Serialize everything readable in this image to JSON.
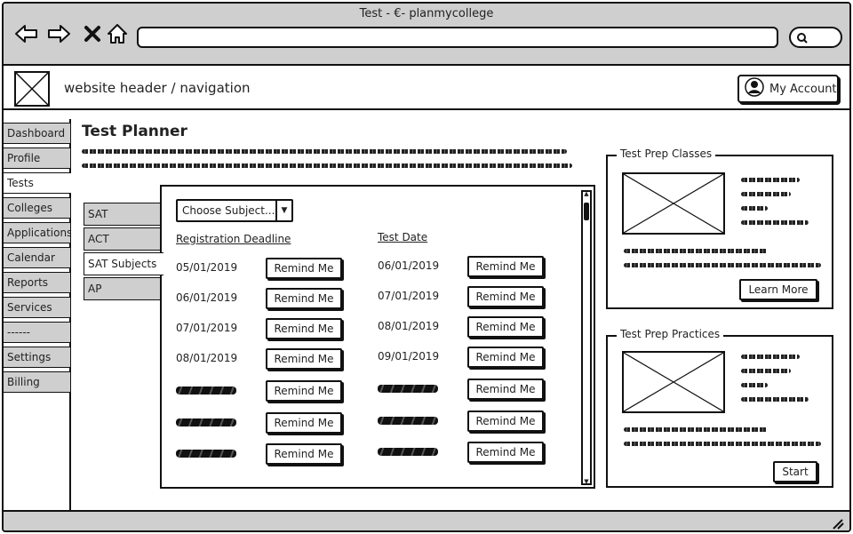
{
  "window": {
    "title": "Test - €- planmycollege"
  },
  "header": {
    "nav_text": "website header / navigation",
    "account_label": "My Account"
  },
  "sidebar": {
    "items": [
      {
        "label": "Dashboard",
        "active": false
      },
      {
        "label": "Profile",
        "active": false
      },
      {
        "label": "Tests",
        "active": true
      },
      {
        "label": "Colleges",
        "active": false
      },
      {
        "label": "Applications",
        "active": false
      },
      {
        "label": "Calendar",
        "active": false
      },
      {
        "label": "Reports",
        "active": false
      },
      {
        "label": "Services",
        "active": false
      },
      {
        "label": "------",
        "active": false
      },
      {
        "label": "Settings",
        "active": false
      },
      {
        "label": "Billing",
        "active": false
      }
    ]
  },
  "main": {
    "title": "Test Planner",
    "subtabs": [
      {
        "label": "SAT",
        "active": false
      },
      {
        "label": "ACT",
        "active": false
      },
      {
        "label": "SAT Subjects",
        "active": true
      },
      {
        "label": "AP",
        "active": false
      }
    ],
    "subject_select": "Choose Subject...",
    "col_registration": "Registration Deadline",
    "col_test_date": "Test Date",
    "remind_label": "Remind Me",
    "rows": [
      {
        "reg": "05/01/2019",
        "test": "06/01/2019"
      },
      {
        "reg": "06/01/2019",
        "test": "07/01/2019"
      },
      {
        "reg": "07/01/2019",
        "test": "08/01/2019"
      },
      {
        "reg": "08/01/2019",
        "test": "09/01/2019"
      },
      {
        "reg": "",
        "test": ""
      },
      {
        "reg": "",
        "test": ""
      },
      {
        "reg": "",
        "test": ""
      }
    ]
  },
  "prep_classes": {
    "title": "Test Prep Classes",
    "button": "Learn More"
  },
  "prep_practices": {
    "title": "Test Prep Practices",
    "button": "Start"
  },
  "colors": {
    "chrome_gray": "#cfcfcf",
    "ink": "#111111"
  }
}
